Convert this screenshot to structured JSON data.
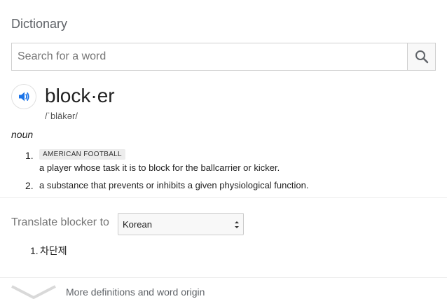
{
  "header": {
    "title": "Dictionary"
  },
  "search": {
    "placeholder": "Search for a word",
    "value": ""
  },
  "entry": {
    "word": "block·er",
    "phonetic": "/ˈbläkər/",
    "part_of_speech": "noun",
    "definitions": [
      {
        "number": "1.",
        "tag": "AMERICAN FOOTBALL",
        "text": "a player whose task it is to block for the ballcarrier or kicker."
      },
      {
        "number": "2.",
        "text": "a substance that prevents or inhibits a given physiological function."
      }
    ]
  },
  "translate": {
    "label": "Translate blocker to",
    "selected_language": "Korean",
    "results": [
      {
        "number": "1.",
        "text": "차단제"
      }
    ]
  },
  "footer": {
    "more_label": "More definitions and word origin"
  },
  "colors": {
    "accent_blue": "#1a73e8",
    "muted_text": "#757575",
    "divider": "#ebebeb"
  }
}
